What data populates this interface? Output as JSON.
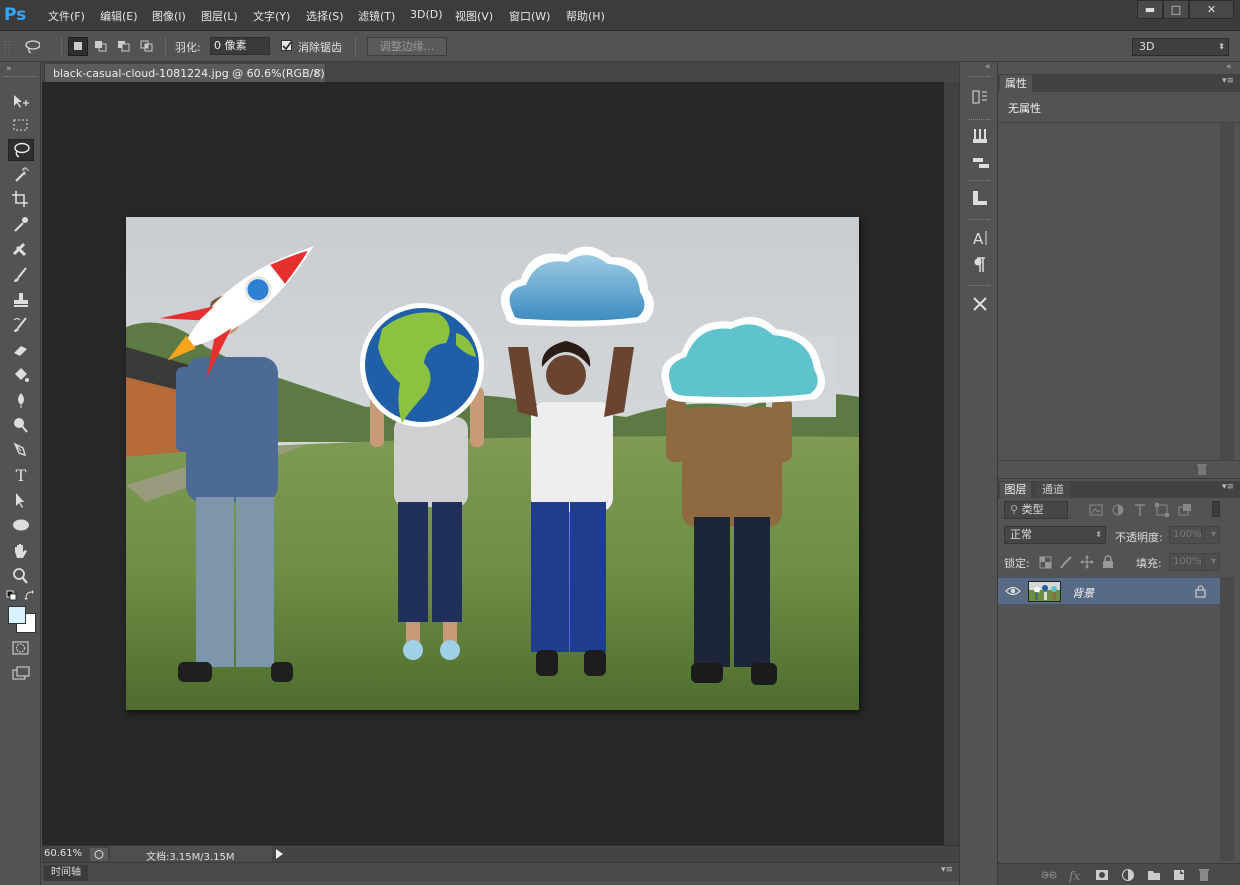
{
  "app": {
    "logo": "Ps"
  },
  "menu": [
    "文件(F)",
    "编辑(E)",
    "图像(I)",
    "图层(L)",
    "文字(Y)",
    "选择(S)",
    "滤镜(T)",
    "3D(D)",
    "视图(V)",
    "窗口(W)",
    "帮助(H)"
  ],
  "window_controls": {
    "minimize": "▬",
    "maximize": "□",
    "close": "✕"
  },
  "options": {
    "feather_label": "羽化:",
    "feather_value": "0 像素",
    "antialias_label": "消除锯齿",
    "antialias_checked": true,
    "refine_edge_label": "调整边缘...",
    "workspace": "3D"
  },
  "document": {
    "tab_title": "black-casual-cloud-1081224.jpg @ 60.6%(RGB/8)",
    "tab_close": "×",
    "zoom": "60.61%",
    "doc_size": "文档:3.15M/3.15M",
    "timeline_label": "时间轴"
  },
  "tools": [
    "move-tool",
    "rectangular-marquee-tool",
    "lasso-tool",
    "magic-wand-tool",
    "crop-tool",
    "eyedropper-tool",
    "healing-brush-tool",
    "brush-tool",
    "clone-stamp-tool",
    "history-brush-tool",
    "eraser-tool",
    "paint-bucket-tool",
    "blur-tool",
    "dodge-tool",
    "pen-tool",
    "type-tool",
    "path-selection-tool",
    "ellipse-tool",
    "hand-tool",
    "zoom-tool"
  ],
  "tool_type_glyph": "T",
  "active_tool": "lasso-tool",
  "colors": {
    "foreground": "#d8f3ff",
    "background": "#ffffff",
    "accent": "#31a8ff",
    "layer_selected": "#596a85"
  },
  "properties_panel": {
    "tab": "属性",
    "content": "无属性"
  },
  "layers_panel": {
    "tabs": [
      "图层",
      "通道"
    ],
    "filter_label": "类型",
    "blend_mode": "正常",
    "opacity_label": "不透明度:",
    "opacity_value": "100%",
    "lock_label": "锁定:",
    "fill_label": "填充:",
    "fill_value": "100%",
    "layers": [
      {
        "name": "背景",
        "visible": true,
        "locked": true
      }
    ]
  }
}
